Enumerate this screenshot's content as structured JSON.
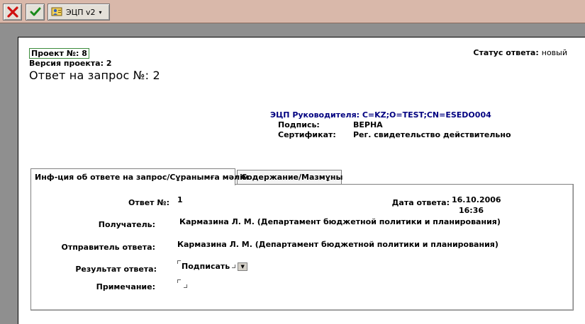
{
  "toolbar": {
    "cancel_icon": "cross-icon",
    "ok_icon": "check-icon",
    "ecp_label": "ЭЦП v2",
    "ecp_icon": "certificate-icon",
    "arrow": "▾"
  },
  "project": {
    "number": "Проект №: 8",
    "version": "Версия проекта: 2",
    "answer_title": "Ответ на запрос №:  2"
  },
  "status": {
    "label": "Статус ответа:",
    "value": "новый"
  },
  "signature": {
    "head": "ЭЦП Руководителя: C=KZ;O=TEST;CN=ESEDO004",
    "sign_label": "Подпись:",
    "sign_value": "ВЕРНА",
    "cert_label": "Сертификат:",
    "cert_value": "Рег. свидетельство действительно"
  },
  "tabs": {
    "info": "Инф-ция об ответе на запрос/Сұранымға мәлім",
    "content": "Содержание/Мазмұны"
  },
  "form": {
    "answer_no_label": "Ответ №:",
    "answer_no_value": "1",
    "date_label": "Дата ответа:",
    "date_value": "16.10.2006",
    "time_value": "16:36",
    "recipient_label": "Получатель:",
    "recipient_value": "Кармазина Л. М. (Департамент бюджетной политики и планирования)",
    "sender_label": "Отправитель ответа:",
    "sender_value": "Кармазина Л. М. (Департамент бюджетной политики и планирования)",
    "result_label": "Результат ответа:",
    "result_value": "Подписать",
    "note_label": "Примечание:",
    "note_value": ""
  },
  "colors": {
    "toolbar_bg": "#d9b8aa",
    "sheet_bg": "#8f8f8f",
    "signature_head": "#000080",
    "cancel_red": "#d01010",
    "ok_green": "#1a8a1a"
  }
}
